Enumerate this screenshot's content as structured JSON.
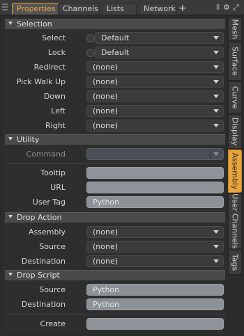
{
  "tabs": [
    "Properties",
    "Channels",
    "Lists",
    "Network"
  ],
  "tab_add": "+",
  "toolbar_icons": [
    "arrows-icon",
    "gear-icon",
    "expand-icon"
  ],
  "sections": {
    "selection": {
      "title": "Selection",
      "rows": [
        {
          "label": "Select",
          "value": "Default",
          "radio": true
        },
        {
          "label": "Lock",
          "value": "Default",
          "radio": true
        },
        {
          "label": "Redirect",
          "value": "(none)"
        },
        {
          "label": "Pick Walk Up",
          "value": "(none)"
        },
        {
          "label": "Down",
          "value": "(none)"
        },
        {
          "label": "Left",
          "value": "(none)"
        },
        {
          "label": "Right",
          "value": "(none)"
        }
      ]
    },
    "utility": {
      "title": "Utility",
      "command_label": "Command",
      "tooltip_label": "Tooltip",
      "url_label": "URL",
      "usertag_label": "User Tag",
      "usertag_value": "Python"
    },
    "drop_action": {
      "title": "Drop Action",
      "rows": [
        {
          "label": "Assembly",
          "value": "(none)"
        },
        {
          "label": "Source",
          "value": "(none)"
        },
        {
          "label": "Destination",
          "value": "(none)"
        }
      ]
    },
    "drop_script": {
      "title": "Drop Script",
      "source_label": "Source",
      "source_value": "Python",
      "destination_label": "Destination",
      "destination_value": "Python",
      "create_label": "Create"
    }
  },
  "vtabs": [
    {
      "label": "Mesh",
      "active": false
    },
    {
      "label": "Surface",
      "active": false
    },
    {
      "label": "Curve",
      "active": false
    },
    {
      "label": "Display",
      "active": false
    },
    {
      "label": "Assembly",
      "active": true
    },
    {
      "label": "User Channels",
      "active": false
    },
    {
      "label": "Tags",
      "active": false
    }
  ],
  "accent_color": "#e8a33a"
}
